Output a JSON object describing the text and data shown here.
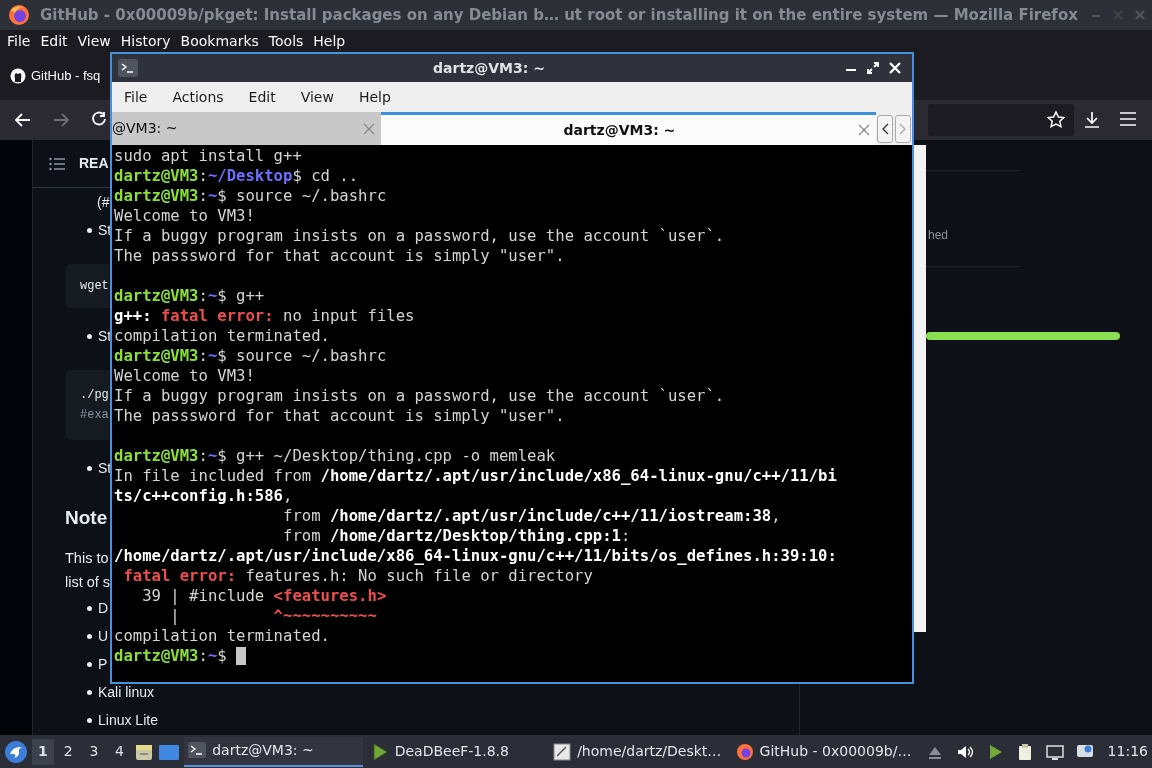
{
  "firefox": {
    "title": "GitHub - 0x00009b/pkget: Install packages on any Debian b… ut root or installing it on the entire system — Mozilla Firefox",
    "menu": [
      "File",
      "Edit",
      "View",
      "History",
      "Bookmarks",
      "Tools",
      "Help"
    ],
    "tab": {
      "title": "GitHub - fsq",
      "selected": true
    },
    "nav_buttons": [
      {
        "kind": "back",
        "disabled": false
      },
      {
        "kind": "forward",
        "disabled": true
      },
      {
        "kind": "reload",
        "disabled": false
      }
    ]
  },
  "readme": {
    "title": "REA",
    "blocks": [
      {
        "kind": "text",
        "text": "(#"
      },
      {
        "kind": "bullet",
        "text": "St"
      },
      {
        "kind": "code",
        "lines": [
          "wget"
        ]
      },
      {
        "kind": "bullet",
        "text": "St"
      },
      {
        "kind": "code",
        "lines": [
          "./pg",
          "#exa"
        ]
      },
      {
        "kind": "bullet",
        "text": "St"
      },
      {
        "kind": "heading",
        "text": "Note"
      },
      {
        "kind": "para",
        "lines": [
          "This to",
          "list of s"
        ]
      },
      {
        "kind": "bullet",
        "text": "D"
      },
      {
        "kind": "bullet",
        "text": "U"
      },
      {
        "kind": "bullet",
        "text": "P"
      },
      {
        "kind": "bullet",
        "text": "Kali linux"
      },
      {
        "kind": "bullet",
        "text": "Linux Lite"
      }
    ]
  },
  "side_panel": {
    "text": "hed"
  },
  "terminal": {
    "title": "dartz@VM3: ~",
    "menu": [
      "File",
      "Actions",
      "Edit",
      "View",
      "Help"
    ],
    "tabs": [
      {
        "label": "@VM3: ~",
        "selected": false
      },
      {
        "label": "dartz@VM3: ~",
        "selected": true
      }
    ],
    "lines": [
      {
        "kind": "text",
        "segments": [
          {
            "kind": "plain",
            "t": "sudo apt install g++"
          }
        ]
      },
      {
        "kind": "text",
        "segments": [
          {
            "kind": "user",
            "t": "dartz@VM3"
          },
          {
            "kind": "plain",
            "t": ":"
          },
          {
            "kind": "path",
            "t": "~/Desktop"
          },
          {
            "kind": "plain",
            "t": "$ cd .."
          }
        ]
      },
      {
        "kind": "text",
        "segments": [
          {
            "kind": "user",
            "t": "dartz@VM3"
          },
          {
            "kind": "plain",
            "t": ":"
          },
          {
            "kind": "path",
            "t": "~"
          },
          {
            "kind": "plain",
            "t": "$ source ~/.bashrc"
          }
        ]
      },
      {
        "kind": "text",
        "segments": [
          {
            "kind": "plain",
            "t": "Welcome to VM3!"
          }
        ]
      },
      {
        "kind": "text",
        "segments": [
          {
            "kind": "plain",
            "t": "If a buggy program insists on a password, use the account `user`."
          }
        ]
      },
      {
        "kind": "text",
        "segments": [
          {
            "kind": "plain",
            "t": "The passsword for that account is simply \"user\"."
          }
        ]
      },
      {
        "kind": "blank"
      },
      {
        "kind": "text",
        "segments": [
          {
            "kind": "user",
            "t": "dartz@VM3"
          },
          {
            "kind": "plain",
            "t": ":"
          },
          {
            "kind": "path",
            "t": "~"
          },
          {
            "kind": "plain",
            "t": "$ g++"
          }
        ]
      },
      {
        "kind": "text",
        "segments": [
          {
            "kind": "bold",
            "t": "g++: "
          },
          {
            "kind": "error",
            "t": "fatal error:"
          },
          {
            "kind": "plain",
            "t": " no input files"
          }
        ]
      },
      {
        "kind": "text",
        "segments": [
          {
            "kind": "plain",
            "t": "compilation terminated."
          }
        ]
      },
      {
        "kind": "text",
        "segments": [
          {
            "kind": "user",
            "t": "dartz@VM3"
          },
          {
            "kind": "plain",
            "t": ":"
          },
          {
            "kind": "path",
            "t": "~"
          },
          {
            "kind": "plain",
            "t": "$ source ~/.bashrc"
          }
        ]
      },
      {
        "kind": "text",
        "segments": [
          {
            "kind": "plain",
            "t": "Welcome to VM3!"
          }
        ]
      },
      {
        "kind": "text",
        "segments": [
          {
            "kind": "plain",
            "t": "If a buggy program insists on a password, use the account `user`."
          }
        ]
      },
      {
        "kind": "text",
        "segments": [
          {
            "kind": "plain",
            "t": "The passsword for that account is simply \"user\"."
          }
        ]
      },
      {
        "kind": "blank"
      },
      {
        "kind": "text",
        "segments": [
          {
            "kind": "user",
            "t": "dartz@VM3"
          },
          {
            "kind": "plain",
            "t": ":"
          },
          {
            "kind": "path",
            "t": "~"
          },
          {
            "kind": "plain",
            "t": "$ g++ ~/Desktop/thing.cpp -o memleak"
          }
        ]
      },
      {
        "kind": "text",
        "segments": [
          {
            "kind": "plain",
            "t": "In file included from "
          },
          {
            "kind": "bold",
            "t": "/home/dartz/.apt/usr/include/x86_64-linux-gnu/c++/11/bi"
          }
        ]
      },
      {
        "kind": "text",
        "segments": [
          {
            "kind": "bold",
            "t": "ts/c++config.h:586"
          },
          {
            "kind": "plain",
            "t": ","
          }
        ]
      },
      {
        "kind": "text",
        "segments": [
          {
            "kind": "plain",
            "t": "                  from "
          },
          {
            "kind": "bold",
            "t": "/home/dartz/.apt/usr/include/c++/11/iostream:38"
          },
          {
            "kind": "plain",
            "t": ","
          }
        ]
      },
      {
        "kind": "text",
        "segments": [
          {
            "kind": "plain",
            "t": "                  from "
          },
          {
            "kind": "bold",
            "t": "/home/dartz/Desktop/thing.cpp:1"
          },
          {
            "kind": "plain",
            "t": ":"
          }
        ]
      },
      {
        "kind": "text",
        "segments": [
          {
            "kind": "bold",
            "t": "/home/dartz/.apt/usr/include/x86_64-linux-gnu/c++/11/bits/os_defines.h:39:10:"
          }
        ]
      },
      {
        "kind": "text",
        "segments": [
          {
            "kind": "error",
            "t": " fatal error:"
          },
          {
            "kind": "plain",
            "t": " features.h: No such file or directory"
          }
        ]
      },
      {
        "kind": "text",
        "segments": [
          {
            "kind": "plain",
            "t": "   39 | #include "
          },
          {
            "kind": "error",
            "t": "<features.h>"
          }
        ]
      },
      {
        "kind": "text",
        "segments": [
          {
            "kind": "plain",
            "t": "      |          "
          },
          {
            "kind": "error",
            "t": "^~~~~~~~~~~"
          }
        ]
      },
      {
        "kind": "text",
        "segments": [
          {
            "kind": "plain",
            "t": "compilation terminated."
          }
        ]
      },
      {
        "kind": "text",
        "cursor": true,
        "segments": [
          {
            "kind": "user",
            "t": "dartz@VM3"
          },
          {
            "kind": "plain",
            "t": ":"
          },
          {
            "kind": "path",
            "t": "~"
          },
          {
            "kind": "plain",
            "t": "$ "
          }
        ]
      }
    ]
  },
  "taskbar": {
    "workspaces": [
      {
        "label": "1",
        "selected": true
      },
      {
        "label": "2",
        "selected": false
      },
      {
        "label": "3",
        "selected": false
      },
      {
        "label": "4",
        "selected": false
      }
    ],
    "tasks": [
      {
        "kind": "terminal",
        "label": "dartz@VM3: ~",
        "selected": true
      },
      {
        "kind": "player",
        "label": "DeaDBeeF-1.8.8",
        "selected": false
      },
      {
        "kind": "editor",
        "label": "/home/dartz/Deskt…",
        "selected": false
      },
      {
        "kind": "browser",
        "label": "GitHub - 0x00009b/…",
        "selected": false
      }
    ],
    "clock": "11:16"
  }
}
